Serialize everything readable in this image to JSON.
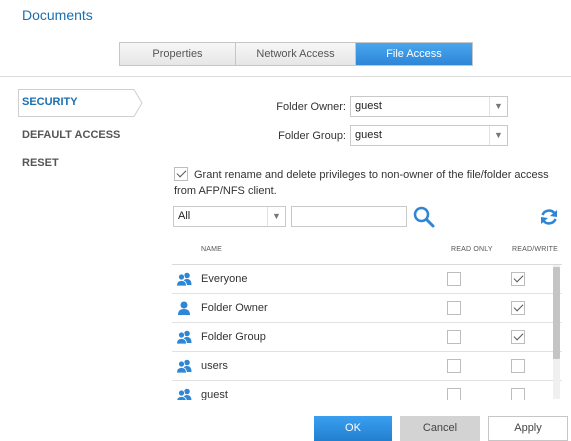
{
  "header": {
    "title": "Documents"
  },
  "tabs": [
    {
      "label": "Properties"
    },
    {
      "label": "Network Access"
    },
    {
      "label": "File Access"
    }
  ],
  "sidebar": {
    "items": [
      {
        "label": "SECURITY"
      },
      {
        "label": "DEFAULT ACCESS"
      },
      {
        "label": "RESET"
      }
    ]
  },
  "form": {
    "owner_label": "Folder Owner:",
    "owner_value": "guest",
    "group_label": "Folder Group:",
    "group_value": "guest",
    "grant_text": "Grant rename and delete privileges to non-owner of the file/folder access from AFP/NFS client.",
    "grant_checked": true
  },
  "filter": {
    "value": "All",
    "search_value": ""
  },
  "table": {
    "columns": {
      "name": "NAME",
      "read_only": "READ ONLY",
      "read_write": "READ/WRITE"
    },
    "rows": [
      {
        "icon": "group-icon",
        "name": "Everyone",
        "read_only": false,
        "read_write": true
      },
      {
        "icon": "user-icon",
        "name": "Folder Owner",
        "read_only": false,
        "read_write": true
      },
      {
        "icon": "group-icon",
        "name": "Folder Group",
        "read_only": false,
        "read_write": true
      },
      {
        "icon": "group-icon",
        "name": "users",
        "read_only": false,
        "read_write": false
      },
      {
        "icon": "group-icon",
        "name": "guest",
        "read_only": false,
        "read_write": false
      }
    ]
  },
  "buttons": {
    "ok": "OK",
    "cancel": "Cancel",
    "apply": "Apply"
  },
  "colors": {
    "accent": "#2d86d6",
    "title": "#1a6fb0"
  }
}
